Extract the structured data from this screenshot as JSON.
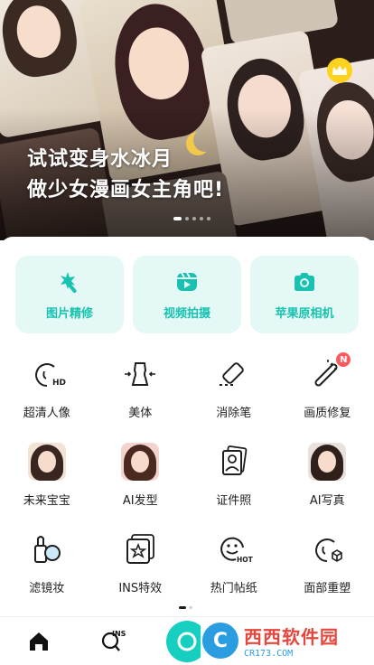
{
  "banner": {
    "headline_line1": "试试变身水冰月",
    "headline_line2": "做少女漫画女主角吧!",
    "carousel_pages": 5,
    "carousel_active": 1,
    "premium_icon": "crown-icon"
  },
  "primary_tools": [
    {
      "label": "图片精修",
      "icon": "magic-wand-icon"
    },
    {
      "label": "视频拍摄",
      "icon": "video-icon"
    },
    {
      "label": "苹果原相机",
      "icon": "camera-icon"
    }
  ],
  "tools": [
    {
      "label": "超清人像",
      "icon": "hd-face-icon"
    },
    {
      "label": "美体",
      "icon": "body-slim-icon"
    },
    {
      "label": "消除笔",
      "icon": "eraser-icon"
    },
    {
      "label": "画质修复",
      "icon": "magic-stick-icon",
      "badge": "N"
    },
    {
      "label": "未来宝宝",
      "icon": "baby-avatar-thumbnail"
    },
    {
      "label": "AI发型",
      "icon": "hairstyle-avatar-thumbnail"
    },
    {
      "label": "证件照",
      "icon": "id-photo-icon"
    },
    {
      "label": "AI写真",
      "icon": "portrait-avatar-thumbnail"
    },
    {
      "label": "滤镜妆",
      "icon": "makeup-filter-icon"
    },
    {
      "label": "INS特效",
      "icon": "ins-effect-icon"
    },
    {
      "label": "热门帖纸",
      "icon": "hot-sticker-icon",
      "icon_text": "HOT"
    },
    {
      "label": "面部重塑",
      "icon": "face-reshape-icon"
    }
  ],
  "grid_pages": {
    "total": 2,
    "active": 1
  },
  "hd_icon_text": "HD",
  "ins_icon_text": "INS",
  "bottom_nav": {
    "home_icon": "home-icon",
    "ins_icon": "ins-search-icon",
    "camera_icon": "camera-icon"
  },
  "watermark": {
    "title": "西西软件园",
    "subtitle": "CR173.COM",
    "logo_letter": "C"
  },
  "colors": {
    "accent": "#19c2b0",
    "card_bg": "#e4f9f6",
    "badge": "#ff5a5f",
    "crown": "#ffd21f"
  }
}
